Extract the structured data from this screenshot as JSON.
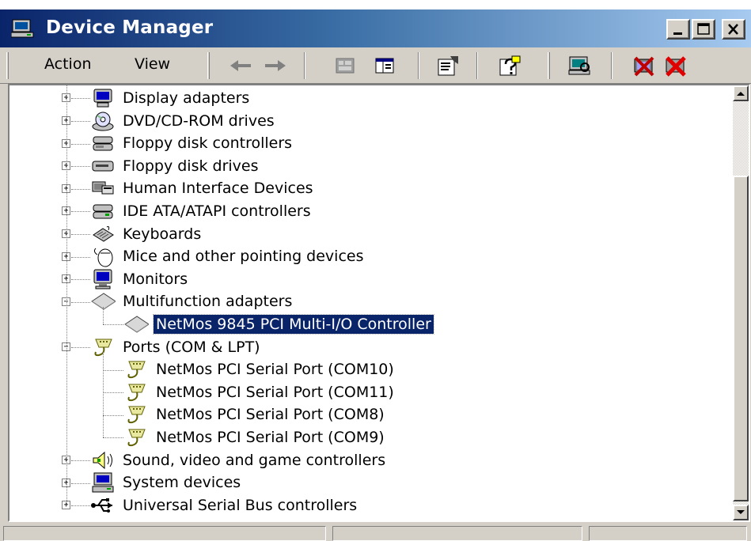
{
  "window": {
    "title": "Device Manager",
    "icon": "computer-manage-icon"
  },
  "menu": {
    "action": "Action",
    "view": "View"
  },
  "toolbar_icons": [
    "back-arrow-icon",
    "forward-arrow-icon",
    "computer-view-icon",
    "split-view-icon",
    "properties-icon",
    "help-icon",
    "scan-hardware-icon",
    "uninstall-icon",
    "disable-icon"
  ],
  "tree": {
    "categories": [
      {
        "label": "Display adapters",
        "icon": "display-adapter-icon",
        "expanded": false
      },
      {
        "label": "DVD/CD-ROM drives",
        "icon": "cdrom-icon",
        "expanded": false
      },
      {
        "label": "Floppy disk controllers",
        "icon": "disk-controller-icon",
        "expanded": false
      },
      {
        "label": "Floppy disk drives",
        "icon": "floppy-drive-icon",
        "expanded": false
      },
      {
        "label": "Human Interface Devices",
        "icon": "hid-icon",
        "expanded": false
      },
      {
        "label": "IDE ATA/ATAPI controllers",
        "icon": "ide-controller-icon",
        "expanded": false
      },
      {
        "label": "Keyboards",
        "icon": "keyboard-icon",
        "expanded": false
      },
      {
        "label": "Mice and other pointing devices",
        "icon": "mouse-icon",
        "expanded": false
      },
      {
        "label": "Monitors",
        "icon": "monitor-icon",
        "expanded": false
      },
      {
        "label": "Multifunction adapters",
        "icon": "multifunction-icon",
        "expanded": true,
        "children": [
          {
            "label": "NetMos 9845 PCI Multi-I/O Controller",
            "icon": "multifunction-icon",
            "selected": true
          }
        ]
      },
      {
        "label": "Ports (COM & LPT)",
        "icon": "port-icon",
        "expanded": true,
        "children": [
          {
            "label": "NetMos PCI Serial Port (COM10)",
            "icon": "port-icon"
          },
          {
            "label": "NetMos PCI Serial Port (COM11)",
            "icon": "port-icon"
          },
          {
            "label": "NetMos PCI Serial Port (COM8)",
            "icon": "port-icon"
          },
          {
            "label": "NetMos PCI Serial Port (COM9)",
            "icon": "port-icon"
          }
        ]
      },
      {
        "label": "Sound, video and game controllers",
        "icon": "sound-icon",
        "expanded": false
      },
      {
        "label": "System devices",
        "icon": "system-device-icon",
        "expanded": false
      },
      {
        "label": "Universal Serial Bus controllers",
        "icon": "usb-icon",
        "expanded": false
      }
    ]
  },
  "expander": {
    "collapsed": "+",
    "expanded": "−"
  },
  "colors": {
    "titlebar_start": "#0a246a",
    "titlebar_end": "#a6caf0",
    "selection": "#0a246a",
    "face": "#d4d0c8"
  }
}
